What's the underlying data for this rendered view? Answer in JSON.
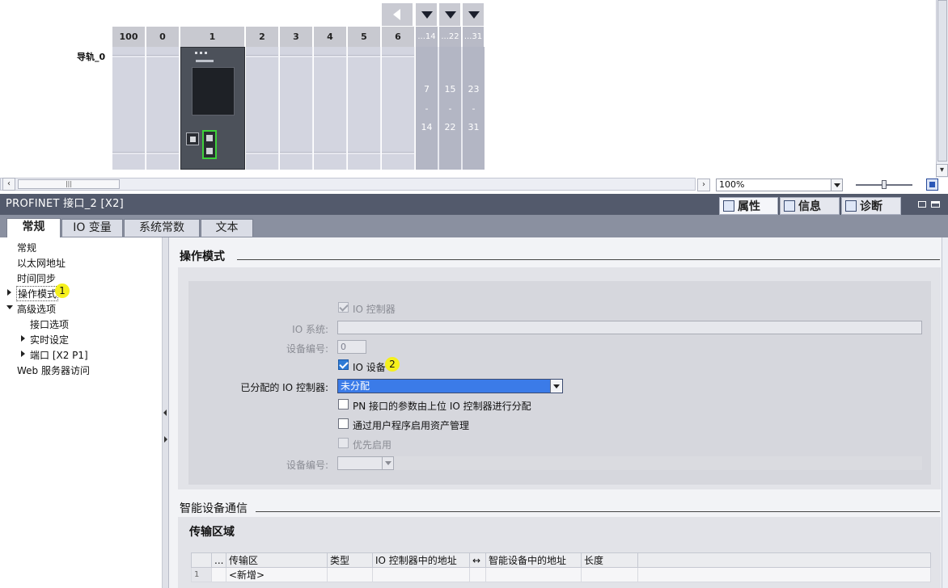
{
  "device_view": {
    "rail_label": "导轨_0",
    "slots": [
      "100",
      "0",
      "1",
      "2",
      "3",
      "4",
      "5",
      "6"
    ],
    "expansion_headers": [
      "...14",
      "...22",
      "...31"
    ],
    "expansion_columns": [
      {
        "from": "7",
        "dash": "-",
        "to": "14"
      },
      {
        "from": "15",
        "dash": "-",
        "to": "22"
      },
      {
        "from": "23",
        "dash": "-",
        "to": "31"
      }
    ],
    "zoom": "100%",
    "scroll_thumb_glyph": "|||"
  },
  "inspector": {
    "title": "PROFINET 接口_2 [X2]",
    "right_tabs": [
      {
        "label": "属性",
        "icon": "properties-icon"
      },
      {
        "label": "信息",
        "icon": "info-icon"
      },
      {
        "label": "诊断",
        "icon": "diagnostics-icon"
      }
    ],
    "sub_tabs": [
      "常规",
      "IO 变量",
      "系统常数",
      "文本"
    ]
  },
  "nav": {
    "items": [
      "常规",
      "以太网地址",
      "时间同步",
      "操作模式",
      "高级选项",
      "接口选项",
      "实时设定",
      "端口 [X2 P1]",
      "Web 服务器访问"
    ],
    "markers": [
      "1",
      "2"
    ]
  },
  "operating_mode": {
    "title": "操作模式",
    "io_controller_label": "IO 控制器",
    "io_system_label": "IO 系统:",
    "device_number_label": "设备编号:",
    "device_number_value": "0",
    "io_device_label": "IO 设备",
    "assigned_controller_label": "已分配的 IO 控制器:",
    "assigned_controller_value": "未分配",
    "pn_param_label": "PN 接口的参数由上位 IO 控制器进行分配",
    "asset_mgmt_label": "通过用户程序启用资产管理",
    "priority_startup_label": "优先启用",
    "device_number_label2": "设备编号:"
  },
  "i_device": {
    "title": "智能设备通信",
    "transfer_area_title": "传输区域",
    "columns": [
      "...",
      "传输区",
      "类型",
      "IO 控制器中的地址",
      "↔",
      "智能设备中的地址",
      "长度"
    ],
    "rows": [
      {
        "index": "1",
        "name": "<新增>"
      }
    ]
  }
}
